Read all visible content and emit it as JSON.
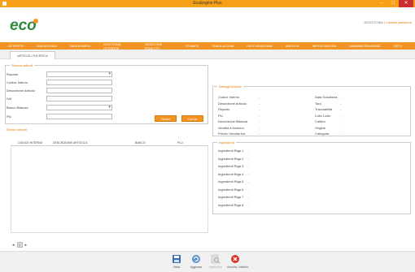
{
  "window": {
    "title": "EcoEngine Plus"
  },
  "user": {
    "name": "AGOSTO/BA",
    "separator": "|",
    "logout": "Cambia password"
  },
  "menu": [
    "OFFERTE",
    "MAGAZZINO",
    "INVENTARIO",
    "GESTIONE OFFERTE",
    "GESTIONE FIDELITY",
    "STAMPE",
    "SIMULAZIONI",
    "FATTURAZIONE",
    "ARCHIVI",
    "IMPOSTAZIONI",
    "AMMINISTRAZIONE",
    "INFO"
  ],
  "tabs": {
    "active": "ARTICOLI RICERCA"
  },
  "search": {
    "legend": "Ricerca articoli",
    "fields": {
      "reparto": "Reparto",
      "codice": "Codice Interno",
      "descrizione": "Descrizione Articolo",
      "iva": "IVA",
      "banco": "Banco Bilancia",
      "plu": "Plu"
    },
    "reset_label": "Reset",
    "search_label": "Cerca"
  },
  "list": {
    "title": "Elenco articoli",
    "columns": [
      "CODICE INTERNO",
      "DESCRIZIONE ARTICOLO",
      "BANCO",
      "PLU"
    ],
    "page": "1"
  },
  "details": {
    "legend": "Dettagli Articolo",
    "left": [
      "Codice Interno",
      "Descrizione Articolo",
      "Reparto",
      "Plu",
      "Descrizione Bilancia",
      "Vendita A Numero",
      "Prezzo Vendita Iva"
    ],
    "right": [
      "Data Scadenza",
      "Tara",
      "Tracciabilità",
      "Lotto Lotto",
      "Calibro",
      "Origine",
      "Categoria"
    ],
    "value": "-"
  },
  "ingredients": {
    "legend": "Ingredienti",
    "rows": [
      "Ingredienti Riga 1",
      "Ingredienti Riga 2",
      "Ingredienti Riga 3",
      "Ingredienti Riga 4",
      "Ingredienti Riga 5",
      "Ingredienti Riga 6",
      "Ingredienti Riga 7",
      "Ingredienti Riga 8"
    ],
    "value": "-"
  },
  "footer": {
    "save": "Salva",
    "refresh": "Aggiorna",
    "preview": "Anteprima",
    "cancel": "Annulla / Indietro"
  },
  "colors": {
    "accent": "#f39323",
    "titlebar": "#f6a018",
    "close": "#c9302c"
  }
}
